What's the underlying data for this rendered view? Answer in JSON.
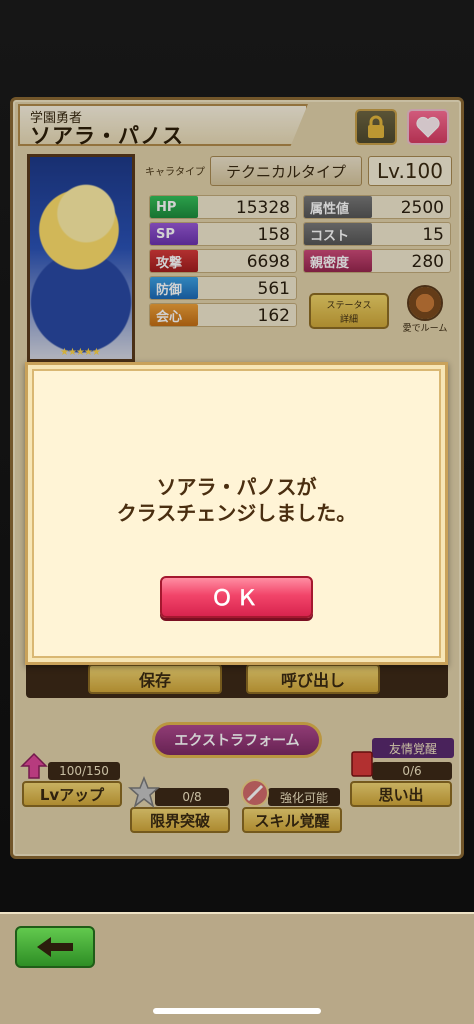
{
  "character": {
    "title": "学園勇者",
    "name": "ソアラ・パノス",
    "type_label": "キャラタイプ",
    "type_value": "テクニカルタイプ",
    "level": "Lv.100",
    "rarity_stars": "★★★★★"
  },
  "stats_left": [
    {
      "label": "HP",
      "value": "15328"
    },
    {
      "label": "SP",
      "value": "158"
    },
    {
      "label": "攻撃",
      "value": "6698"
    },
    {
      "label": "防御",
      "value": "561"
    },
    {
      "label": "会心",
      "value": "162"
    }
  ],
  "stats_right": [
    {
      "label": "属性値",
      "value": "2500"
    },
    {
      "label": "コスト",
      "value": "15"
    },
    {
      "label": "親密度",
      "value": "280"
    }
  ],
  "buttons": {
    "status_detail": "ステータス\n詳細",
    "room": "愛でルーム",
    "save": "保存",
    "load": "呼び出し",
    "extraform": "エクストラフォーム",
    "lvup": "Lvアップ",
    "lvup_count": "100/150",
    "limit_break": "限界突破",
    "limit_count": "0/8",
    "skill_awaken": "スキル覚醒",
    "skill_tag": "強化可能",
    "memory": "思い出",
    "memory_count": "0/6",
    "friendship_tag": "友情覚醒"
  },
  "dialog": {
    "message_line1": "ソアラ・パノスが",
    "message_line2": "クラスチェンジしました。",
    "ok": "ＯＫ"
  },
  "colors": {
    "ok_button": "#f2456a",
    "panel": "#e3d3ab",
    "dialog_bg": "#fff4d6"
  }
}
